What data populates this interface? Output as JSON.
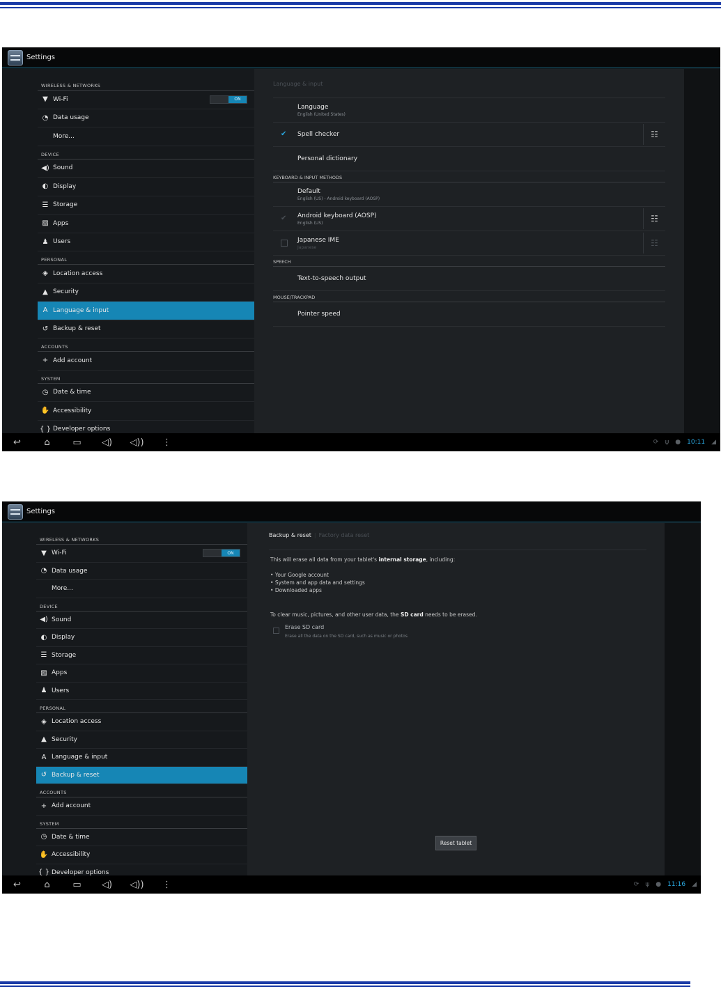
{
  "screenshot1": {
    "app_title": "Settings",
    "sidebar": [
      {
        "type": "header",
        "label": "WIRELESS & NETWORKS"
      },
      {
        "type": "item",
        "label": "Wi-Fi",
        "icon": "wifi-icon",
        "glyph": "▼",
        "toggle": "ON"
      },
      {
        "type": "item",
        "label": "Data usage",
        "icon": "data-usage-icon",
        "glyph": "◔"
      },
      {
        "type": "item",
        "label": "More...",
        "icon": "",
        "glyph": ""
      },
      {
        "type": "header",
        "label": "DEVICE"
      },
      {
        "type": "item",
        "label": "Sound",
        "icon": "sound-icon",
        "glyph": "◀)"
      },
      {
        "type": "item",
        "label": "Display",
        "icon": "display-icon",
        "glyph": "◐"
      },
      {
        "type": "item",
        "label": "Storage",
        "icon": "storage-icon",
        "glyph": "☰"
      },
      {
        "type": "item",
        "label": "Apps",
        "icon": "apps-icon",
        "glyph": "▨"
      },
      {
        "type": "item",
        "label": "Users",
        "icon": "users-icon",
        "glyph": "♟"
      },
      {
        "type": "header",
        "label": "PERSONAL"
      },
      {
        "type": "item",
        "label": "Location access",
        "icon": "location-icon",
        "glyph": "◈"
      },
      {
        "type": "item",
        "label": "Security",
        "icon": "lock-icon",
        "glyph": "▲"
      },
      {
        "type": "item",
        "label": "Language & input",
        "icon": "language-icon",
        "glyph": "A",
        "active": true
      },
      {
        "type": "item",
        "label": "Backup & reset",
        "icon": "backup-icon",
        "glyph": "↺"
      },
      {
        "type": "header",
        "label": "ACCOUNTS"
      },
      {
        "type": "item",
        "label": "Add account",
        "icon": "add-icon",
        "glyph": "+"
      },
      {
        "type": "header",
        "label": "SYSTEM"
      },
      {
        "type": "item",
        "label": "Date & time",
        "icon": "clock-icon",
        "glyph": "◷"
      },
      {
        "type": "item",
        "label": "Accessibility",
        "icon": "accessibility-icon",
        "glyph": "✋"
      },
      {
        "type": "item",
        "label": "Developer options",
        "icon": "developer-icon",
        "glyph": "{ }"
      }
    ],
    "pane_title": "Language & input",
    "prefs": [
      {
        "type": "item",
        "title": "Language",
        "sub": "English (United States)",
        "h": 35
      },
      {
        "type": "item",
        "title": "Spell checker",
        "check": "checked",
        "settings": true,
        "h": 35
      },
      {
        "type": "item",
        "title": "Personal dictionary",
        "h": 35
      },
      {
        "type": "header",
        "label": "KEYBOARD & INPUT METHODS"
      },
      {
        "type": "item",
        "title": "Default",
        "sub": "English (US) - Android keyboard (AOSP)",
        "h": 35
      },
      {
        "type": "item",
        "title": "Android keyboard (AOSP)",
        "sub": "English (US)",
        "check": "dim",
        "settings": true,
        "h": 35
      },
      {
        "type": "item",
        "title": "Japanese IME",
        "sub": "Japanese",
        "subfaint": true,
        "check": "box",
        "settings": "faint",
        "h": 35
      },
      {
        "type": "header",
        "label": "SPEECH"
      },
      {
        "type": "item",
        "title": "Text-to-speech output",
        "h": 35
      },
      {
        "type": "header",
        "label": "MOUSE/TRACKPAD"
      },
      {
        "type": "item",
        "title": "Pointer speed",
        "h": 35
      }
    ],
    "clock": "10:11"
  },
  "screenshot2": {
    "app_title": "Settings",
    "sidebar_active": "Backup & reset",
    "tab_active": "Backup & reset",
    "tab_inactive": "Factory data reset",
    "intro_pre": "This will erase all data from your tablet's ",
    "intro_bold": "internal storage",
    "intro_post": ", including:",
    "bullets": [
      "Your Google account",
      "System and app data and settings",
      "Downloaded apps"
    ],
    "sd_pre": "To clear music, pictures, and other user data, the ",
    "sd_bold": "SD card",
    "sd_post": " needs to be erased.",
    "erase_title": "Erase SD card",
    "erase_sub": "Erase all the data on the SD card, such as music or photos",
    "reset_button": "Reset tablet",
    "clock": "11:16"
  },
  "nav_buttons": [
    {
      "name": "back-button",
      "glyph": "↩"
    },
    {
      "name": "home-button",
      "glyph": "⌂"
    },
    {
      "name": "recents-button",
      "glyph": "▭"
    },
    {
      "name": "volume-down-button",
      "glyph": "◁)"
    },
    {
      "name": "volume-up-button",
      "glyph": "◁))"
    },
    {
      "name": "menu-button",
      "glyph": "⋮"
    }
  ],
  "status_icons": [
    "⟳",
    "ψ",
    "●"
  ],
  "colors": {
    "accent": "#1686b5",
    "clock": "#2aa8e0",
    "rule": "#1a3aa6"
  }
}
